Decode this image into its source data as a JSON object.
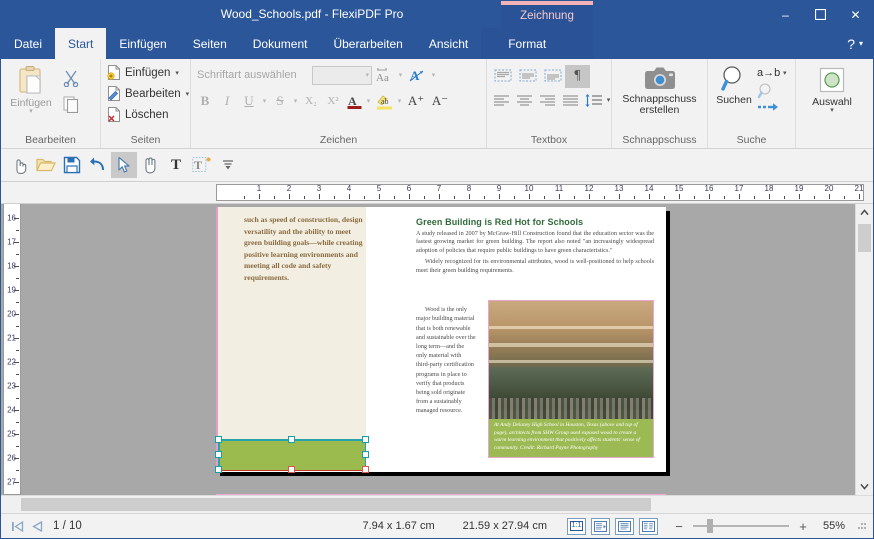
{
  "window": {
    "title": "Wood_Schools.pdf - FlexiPDF Pro",
    "minimize": "–",
    "maximize": "☐",
    "close": "✕",
    "help": "?",
    "help_caret": "▾"
  },
  "contextual": {
    "banner_label": "Zeichnung",
    "tab_label": "Format"
  },
  "tabs": [
    {
      "label": "Datei",
      "active": false
    },
    {
      "label": "Start",
      "active": true
    },
    {
      "label": "Einfügen",
      "active": false
    },
    {
      "label": "Seiten",
      "active": false
    },
    {
      "label": "Dokument",
      "active": false
    },
    {
      "label": "Überarbeiten",
      "active": false
    },
    {
      "label": "Ansicht",
      "active": false
    }
  ],
  "ribbon": {
    "groups": [
      {
        "title": "Bearbeiten"
      },
      {
        "title": "Seiten"
      },
      {
        "title": "Zeichen"
      },
      {
        "title": "Textbox"
      },
      {
        "title": "Schnappschuss"
      },
      {
        "title": "Suche"
      },
      {
        "title": ""
      }
    ],
    "clipboard": {
      "paste_label": "Einfügen",
      "paste_caret": "▾",
      "cut_icon": "scissors-icon",
      "copy_icon": "copy-icon"
    },
    "pages": {
      "insert_label": "Einfügen",
      "edit_label": "Bearbeiten",
      "delete_label": "Löschen",
      "caret": "▾"
    },
    "font": {
      "font_placeholder": "Schriftart auswählen",
      "font_value": "",
      "size_value": "",
      "bold": "B",
      "italic": "I",
      "underline": "U",
      "strikethrough": "S",
      "subscript": "X₂",
      "superscript": "X²",
      "font_color": "A",
      "highlight": "ab",
      "grow_font": "A⁺",
      "shrink_font": "A⁻",
      "change_case": "Aa",
      "text_effects": "A",
      "caret": "▾"
    },
    "textbox": {
      "pilcrow": "¶"
    },
    "snapshot": {
      "label_line1": "Schnappschuss",
      "label_line2": "erstellen"
    },
    "search": {
      "find_label": "Suchen",
      "replace_label": "a→b",
      "caret": "▾"
    },
    "selection": {
      "label": "Auswahl",
      "caret": "▾"
    }
  },
  "quickbar": {
    "buttons": [
      {
        "name": "touch-mode-icon",
        "glyph": "☝"
      },
      {
        "name": "open-folder-icon",
        "glyph": "🗁"
      },
      {
        "name": "save-icon",
        "glyph": "💾"
      },
      {
        "name": "undo-icon",
        "glyph": "↶"
      },
      {
        "name": "select-arrow-icon",
        "glyph": "➤",
        "selected": true
      },
      {
        "name": "hand-pan-icon",
        "glyph": "✋"
      },
      {
        "name": "text-tool-icon",
        "glyph": "T"
      },
      {
        "name": "add-text-tool-icon",
        "glyph": "T⁺"
      },
      {
        "name": "more-options-icon",
        "glyph": "≡"
      }
    ]
  },
  "rulers": {
    "horizontal": [
      1,
      2,
      3,
      4,
      5,
      6,
      7,
      8,
      9,
      10,
      11,
      12,
      13,
      14,
      15,
      16,
      17,
      18,
      19,
      20,
      21
    ],
    "vertical": [
      16,
      17,
      18,
      19,
      20,
      21,
      22,
      23,
      24,
      25,
      26,
      27
    ]
  },
  "document": {
    "left_column_text": "such as speed of construction, design versatility and the ability to meet green building goals—while creating positive learning environments and meeting all code and safety requirements.",
    "article_heading": "Green Building is Red Hot for Schools",
    "article_para1": "A study released in 2007 by McGraw-Hill Construction found that the education sector was the fastest growing market for green building. The report also noted \"an increasingly widespread adoption of policies that require public buildings to have green characteristics.\"",
    "article_para2": "Widely recognized for its environmental attributes, wood is well-positioned to help schools meet their green building requirements.",
    "article_para3": "Wood is the only major building material that is both renewable and sustainable over the long term—and the only material with third-party certification programs in place to verify that products being sold originate from a sustainably managed resource.",
    "photo_caption": "At Andy Delaney High School in Houston, Texas (above and top of page), architects from SHW Group used exposed wood to create a warm learning environment that positively affects students' sense of community. Credit: Richard Payne Photography"
  },
  "statusbar": {
    "first_page_icon": "⏮",
    "prev_page_icon": "◀",
    "page_indicator": "1 / 10",
    "selection_size": "7.94 x 1.67 cm",
    "page_size": "21.59 x 27.94 cm",
    "view_buttons": [
      {
        "name": "actual-size-view-button",
        "label": "1:1"
      },
      {
        "name": "single-page-view-button",
        "label": ""
      },
      {
        "name": "continuous-view-button",
        "label": ""
      },
      {
        "name": "facing-pages-view-button",
        "label": ""
      }
    ],
    "zoom_out": "−",
    "zoom_in": "+",
    "zoom_level": "55%"
  },
  "colors": {
    "accent": "#2b579a",
    "contextual_tab": "#2a5296",
    "contextual_stripe": "#f2b2b6",
    "heading_green": "#2f6b3a",
    "shape_green": "#9cbb4e",
    "caption_green": "#9cba54",
    "selection_handle": "#15a0a8",
    "selection_handle_red": "#d9594c",
    "left_column_bg": "#f2efe2",
    "left_column_text": "#8a6a3f"
  }
}
